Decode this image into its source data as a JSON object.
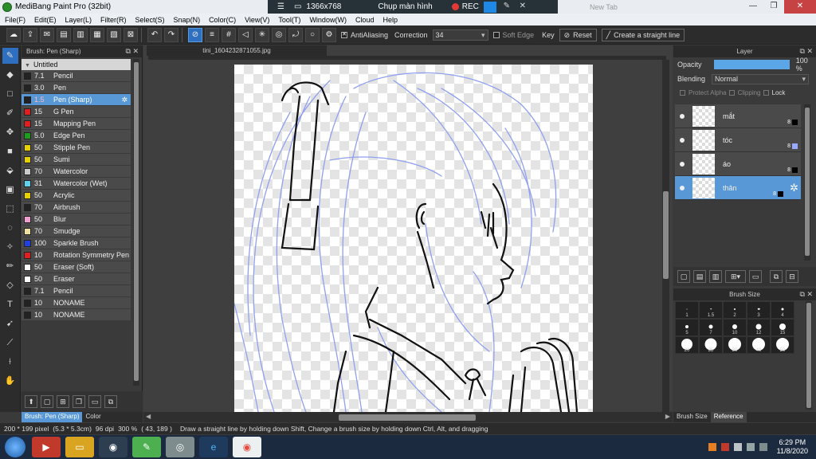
{
  "window": {
    "title": "MediBang Paint Pro (32bit)"
  },
  "recorder": {
    "resolution": "1366x768",
    "capture_label": "Chụp màn hình",
    "rec_label": "REC",
    "ghost_tab": "New Tab"
  },
  "menu": [
    "File(F)",
    "Edit(E)",
    "Layer(L)",
    "Filter(R)",
    "Select(S)",
    "Snap(N)",
    "Color(C)",
    "View(V)",
    "Tool(T)",
    "Window(W)",
    "Cloud",
    "Help"
  ],
  "toolbar": {
    "antialiasing_label": "AntiAliasing",
    "correction_label": "Correction",
    "correction_value": "34",
    "soft_edge_label": "Soft Edge",
    "key_label": "Key",
    "reset_label": "Reset",
    "straight_line_label": "Create a straight line"
  },
  "brush_panel": {
    "title": "Brush: Pen (Sharp)",
    "group": "Untitled",
    "items": [
      {
        "size": "7.1",
        "name": "Pencil",
        "color": "#222222"
      },
      {
        "size": "3.0",
        "name": "Pen",
        "color": "#222222"
      },
      {
        "size": "1.5",
        "name": "Pen (Sharp)",
        "color": "#222222",
        "selected": true
      },
      {
        "size": "15",
        "name": "G Pen",
        "color": "#e02020"
      },
      {
        "size": "15",
        "name": "Mapping Pen",
        "color": "#e02020"
      },
      {
        "size": "5.0",
        "name": "Edge Pen",
        "color": "#1aa01a"
      },
      {
        "size": "50",
        "name": "Stipple Pen",
        "color": "#e6d000"
      },
      {
        "size": "50",
        "name": "Sumi",
        "color": "#e6d000"
      },
      {
        "size": "70",
        "name": "Watercolor",
        "color": "#cccccc"
      },
      {
        "size": "31",
        "name": "Watercolor (Wet)",
        "color": "#5fd0f0"
      },
      {
        "size": "50",
        "name": "Acrylic",
        "color": "#e6d000"
      },
      {
        "size": "70",
        "name": "Airbrush",
        "color": "#222222"
      },
      {
        "size": "50",
        "name": "Blur",
        "color": "#f0a0d0"
      },
      {
        "size": "70",
        "name": "Smudge",
        "color": "#f0e0a0"
      },
      {
        "size": "100",
        "name": "Sparkle Brush",
        "color": "#2040e0"
      },
      {
        "size": "10",
        "name": "Rotation Symmetry Pen",
        "color": "#e02020"
      },
      {
        "size": "50",
        "name": "Eraser (Soft)",
        "color": "#ffffff"
      },
      {
        "size": "50",
        "name": "Eraser",
        "color": "#ffffff"
      },
      {
        "size": "7.1",
        "name": "Pencil",
        "color": "#222222"
      },
      {
        "size": "10",
        "name": "NONAME",
        "color": "#222222"
      },
      {
        "size": "10",
        "name": "NONAME",
        "color": "#222222"
      }
    ],
    "bottom_tabs": [
      "Brush: Pen (Sharp)",
      "Color"
    ]
  },
  "document": {
    "tab": "tini_1604232871055.jpg"
  },
  "layer_panel": {
    "title": "Layer",
    "opacity_label": "Opacity",
    "opacity_value": "100 %",
    "blending_label": "Blending",
    "blending_value": "Normal",
    "protect_alpha_label": "Protect Alpha",
    "clipping_label": "Clipping",
    "lock_label": "Lock",
    "layers": [
      {
        "name": "mắt",
        "mark_color": "#000000"
      },
      {
        "name": "tóc",
        "mark_color": "#9aa8ff"
      },
      {
        "name": "áo",
        "mark_color": "#000000"
      },
      {
        "name": "thân",
        "mark_color": "#000000",
        "selected": true
      }
    ],
    "layer_mark_number": "8"
  },
  "brush_size": {
    "title": "Brush Size",
    "sizes": [
      "1",
      "1.5",
      "2",
      "3",
      "4",
      "5",
      "7",
      "10",
      "12",
      "15",
      "20",
      "25",
      "30",
      "40",
      "50"
    ],
    "tabs": [
      "Brush Size",
      "Reference"
    ]
  },
  "status": {
    "pixels": "200 * 199 pixel",
    "cm": "(5.3 * 5.3cm)",
    "dpi": "96 dpi",
    "zoom": "300 %",
    "coords": "( 43, 189 )",
    "hint": "Draw a straight line by holding down Shift, Change a brush size by holding down Ctrl, Alt, and dragging"
  },
  "taskbar": {
    "time": "6:29 PM",
    "date": "11/8/2020"
  }
}
